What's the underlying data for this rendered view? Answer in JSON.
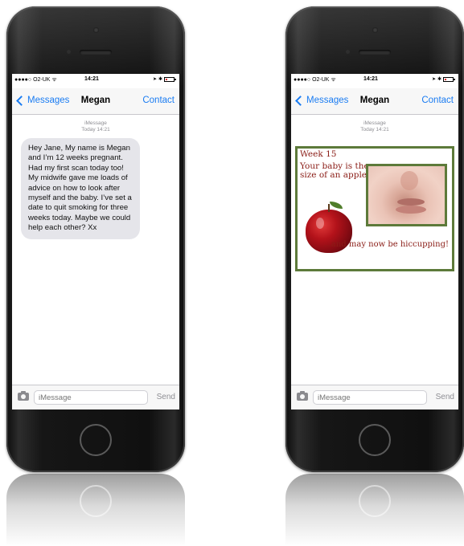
{
  "phones": [
    {
      "status": {
        "carrier": "●●●●○ O2-UK ᯤ",
        "time": "14:21"
      },
      "nav": {
        "back_label": "Messages",
        "title": "Megan",
        "contact_label": "Contact"
      },
      "timestamp": {
        "service": "iMessage",
        "time": "Today 14:21"
      },
      "message": {
        "text": "Hey Jane, My name is Megan and I’m 12 weeks pregnant.  Had my first scan today too! My midwife gave me loads of advice on how to look after myself and the baby. I’ve set a date to quit smoking for three weeks today. Maybe we could help each other? Xx"
      },
      "input": {
        "placeholder": "iMessage",
        "send_label": "Send"
      }
    },
    {
      "status": {
        "carrier": "●●●●○ O2-UK ᯤ",
        "time": "14:21"
      },
      "nav": {
        "back_label": "Messages",
        "title": "Megan",
        "contact_label": "Contact"
      },
      "timestamp": {
        "service": "iMessage",
        "time": "Today 14:21"
      },
      "card": {
        "week": "Week 15",
        "line1": "Your baby is the size of an apple",
        "line2": "...and may now be hiccupping!"
      },
      "input": {
        "placeholder": "iMessage",
        "send_label": "Send"
      }
    }
  ],
  "colors": {
    "ios_blue": "#1a7cf2",
    "bubble_grey": "#e5e5ea",
    "card_green": "#5d7a3a",
    "card_text": "#8a1c16"
  },
  "icons": [
    "back-chevron-icon",
    "camera-icon",
    "battery-icon",
    "apple-image",
    "baby-face-photo"
  ]
}
